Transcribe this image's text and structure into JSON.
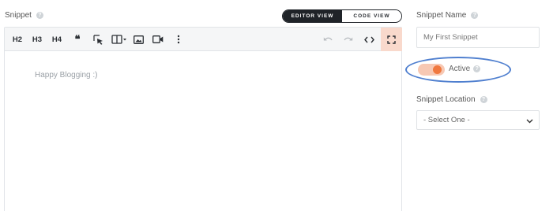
{
  "snippet": {
    "label": "Snippet",
    "view_toggle": {
      "editor_label": "EDITOR VIEW",
      "code_label": "CODE VIEW",
      "active": "editor"
    },
    "toolbar": {
      "h2": "H2",
      "h3": "H3",
      "h4": "H4",
      "quote": "❝"
    },
    "editor_content": "Happy Blogging :)"
  },
  "snippet_name": {
    "label": "Snippet Name",
    "value": "My First Snippet"
  },
  "active_toggle": {
    "label": "Active",
    "state": "on"
  },
  "snippet_location": {
    "label": "Snippet Location",
    "selected": "- Select One -"
  },
  "colors": {
    "accent": "#f0783f",
    "accent_light": "#f7c8b3",
    "highlight_ring": "#4f7fcf",
    "dark": "#1f2328"
  },
  "icons": {
    "help": "question-circle-icon",
    "cursor": "cursor-select-icon",
    "columns": "columns-icon",
    "image": "image-icon",
    "video": "video-icon",
    "more": "more-vertical-icon",
    "undo": "undo-icon",
    "redo": "redo-icon",
    "code": "code-icon",
    "fullscreen": "fullscreen-icon",
    "chevron": "chevron-down-icon"
  }
}
